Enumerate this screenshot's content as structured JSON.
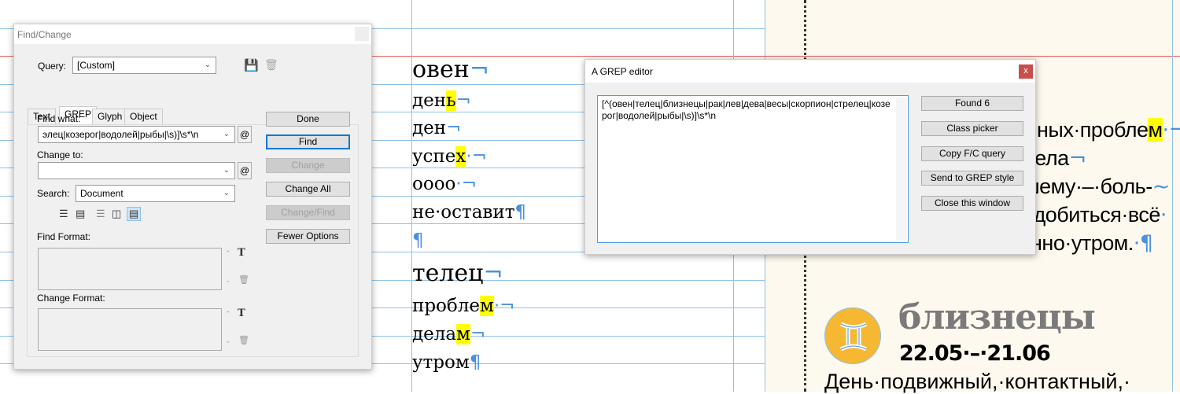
{
  "document": {
    "left_column": [
      {
        "text": "овен",
        "highlight": "",
        "mark": "¬"
      },
      {
        "text": "ден",
        "highlight": "ь",
        "mark": "¬"
      },
      {
        "text": "ден",
        "highlight": "",
        "mark": "¬"
      },
      {
        "text": "успе",
        "highlight": "х",
        "mark": "·¬"
      },
      {
        "text": "оооо",
        "highlight": "",
        "mark": "·¬"
      },
      {
        "text": "не·оставит",
        "highlight": "",
        "mark": "¶"
      },
      {
        "text": "",
        "highlight": "",
        "mark": "¶"
      },
      {
        "text": "телец",
        "highlight": "",
        "mark": "¬"
      },
      {
        "text": "пробле",
        "highlight": "м",
        "mark": "·¬"
      },
      {
        "text": "дела",
        "highlight": "м",
        "mark": "¬"
      },
      {
        "text": "утром",
        "highlight": "",
        "mark": "¶"
      }
    ],
    "right_fragments": [
      {
        "text": "ных·пробле",
        "highlight": "м",
        "mark": "·¬"
      },
      {
        "text": "дела",
        "highlight": "",
        "mark": "¬"
      },
      {
        "text": "шему·–·боль-",
        "highlight": "",
        "mark": "~"
      },
      {
        "text": "·добиться·всё",
        "highlight": "",
        "mark": "·"
      },
      {
        "text": "нно·утром.",
        "highlight": "",
        "mark": "·¶"
      }
    ],
    "sign_title": "близнецы",
    "sign_dates": "22.05·–·21.06",
    "sign_text": "День·подвижный,·контактный,·",
    "accent": "#f6b833"
  },
  "find_change": {
    "title": "Find/Change",
    "query_label": "Query:",
    "query_value": "[Custom]",
    "tabs": [
      "Text",
      "GREP",
      "Glyph",
      "Object"
    ],
    "active_tab": "GREP",
    "find_what_label": "Find what:",
    "find_what_value": "элец|козерог|водолей|рыбы|\\s)]\\s*\\n",
    "change_to_label": "Change to:",
    "change_to_value": "",
    "search_label": "Search:",
    "search_value": "Document",
    "find_format_label": "Find Format:",
    "change_format_label": "Change Format:",
    "buttons": {
      "done": "Done",
      "find": "Find",
      "change": "Change",
      "change_all": "Change All",
      "change_find": "Change/Find",
      "fewer_options": "Fewer Options"
    },
    "special_char_icon": "@"
  },
  "grep_editor": {
    "title": "A GREP editor",
    "close": "x",
    "expression": "[^(овен|телец|близнецы|рак|лев|дева|весы|скорпион|стрелец|козерог|водолей|рыбы|\\s)]\\s*\\n",
    "buttons": {
      "found": "Found 6",
      "class_picker": "Class picker",
      "copy_query": "Copy F/C query",
      "send_grep_style": "Send to GREP style",
      "close_window": "Close this window"
    }
  }
}
